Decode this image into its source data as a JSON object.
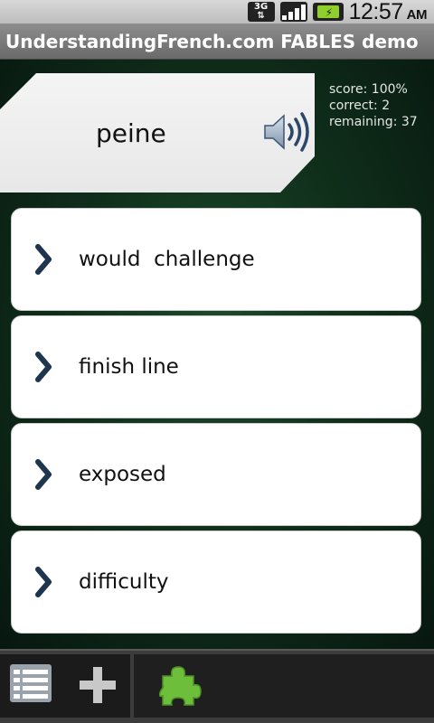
{
  "status_bar": {
    "network": "3G",
    "time": "12:57",
    "ampm": "AM"
  },
  "app": {
    "title": "UnderstandingFrench.com FABLES demo"
  },
  "quiz": {
    "word": "peine",
    "score": "score: 100%",
    "correct": "correct: 2",
    "remaining": "remaining: 37",
    "answers": [
      {
        "label": "would  challenge"
      },
      {
        "label": "finish line"
      },
      {
        "label": "exposed"
      },
      {
        "label": "difficulty"
      }
    ]
  },
  "icons": {
    "speaker": "speaker-icon",
    "chevron": "chevron-right-icon",
    "list": "list-icon",
    "add": "plus-icon",
    "puzzle": "puzzle-icon"
  },
  "colors": {
    "chevron": "#1e3550",
    "puzzle": "#6dbe3a",
    "background": "#10301b"
  }
}
